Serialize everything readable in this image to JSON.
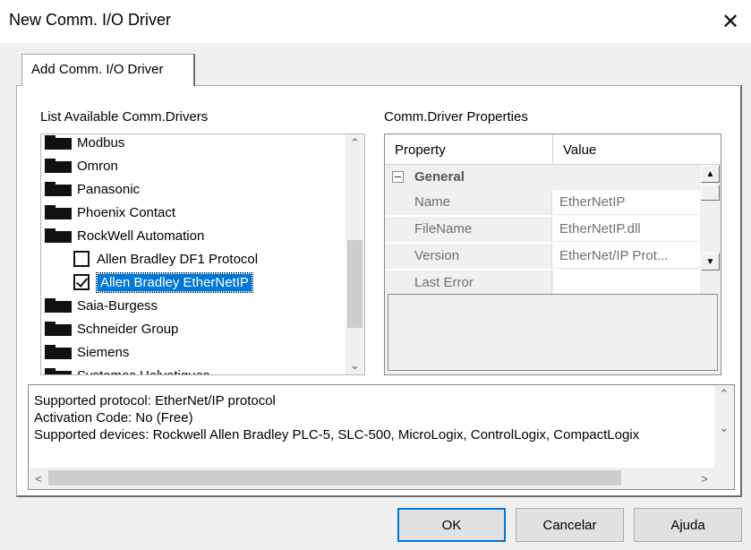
{
  "window": {
    "title": "New Comm. I/O Driver",
    "close_symbol": "✕"
  },
  "tab": {
    "label": "Add Comm. I/O Driver"
  },
  "drivers": {
    "heading": "List Available Comm.Drivers",
    "items": [
      {
        "label": "Modbus",
        "kind": "folder"
      },
      {
        "label": "Omron",
        "kind": "folder"
      },
      {
        "label": "Panasonic",
        "kind": "folder"
      },
      {
        "label": "Phoenix Contact",
        "kind": "folder"
      },
      {
        "label": "RockWell Automation",
        "kind": "folder"
      },
      {
        "label": "Allen Bradley DF1 Protocol",
        "kind": "checkbox",
        "checked": false
      },
      {
        "label": "Allen Bradley EtherNetIP",
        "kind": "checkbox",
        "checked": true,
        "selected": true
      },
      {
        "label": "Saia-Burgess",
        "kind": "folder"
      },
      {
        "label": "Schneider Group",
        "kind": "folder"
      },
      {
        "label": "Siemens",
        "kind": "folder"
      },
      {
        "label": "Systemes Helvetiques",
        "kind": "folder",
        "partially_hidden": true
      }
    ],
    "scroll_up": "⌃",
    "scroll_down": "⌄"
  },
  "properties": {
    "heading": "Comm.Driver Properties",
    "columns": [
      "Property",
      "Value"
    ],
    "category": "General",
    "rows": [
      {
        "name": "Name",
        "value": "EtherNetIP"
      },
      {
        "name": "FileName",
        "value": "EtherNetIP.dll"
      },
      {
        "name": "Version",
        "value": "EtherNet/IP Prot..."
      },
      {
        "name": "Last Error",
        "value": ""
      }
    ]
  },
  "info": {
    "lines": [
      "Supported protocol: EtherNet/IP protocol",
      "Activation Code: No (Free)",
      "Supported devices: Rockwell Allen Bradley PLC-5, SLC-500, MicroLogix, ControlLogix, CompactLogix"
    ],
    "scroll_left": "<",
    "scroll_right": ">"
  },
  "buttons": {
    "ok": "OK",
    "cancel": "Cancelar",
    "help": "Ajuda"
  },
  "colors": {
    "selection": "#0078d7",
    "dialog_bg": "#f0f0f0"
  }
}
